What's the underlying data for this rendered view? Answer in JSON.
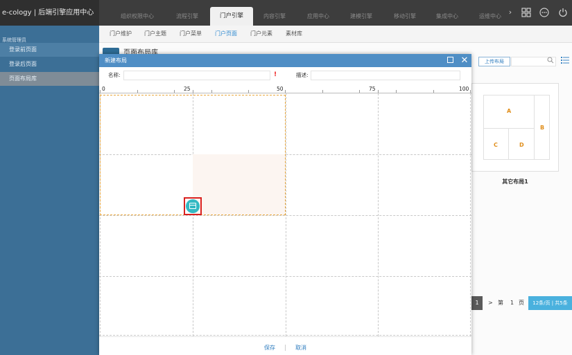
{
  "app": {
    "brand": "e-cology | 后端引擎应用中心"
  },
  "top_nav": {
    "tabs": [
      {
        "label": "组织权限中心"
      },
      {
        "label": "流程引擎"
      },
      {
        "label": "门户引擎"
      },
      {
        "label": "内容引擎"
      },
      {
        "label": "应用中心"
      },
      {
        "label": "建模引擎"
      },
      {
        "label": "移动引擎"
      },
      {
        "label": "集成中心"
      },
      {
        "label": "运维中心"
      }
    ],
    "active_tab": "门户引擎",
    "more_icon": "chevron-right-icon",
    "icons": [
      "grid-icon",
      "more-icon",
      "power-icon"
    ]
  },
  "sub_nav": {
    "items": [
      {
        "label": "门户维护"
      },
      {
        "label": "门户主题"
      },
      {
        "label": "门户菜单"
      },
      {
        "label": "门户页面"
      },
      {
        "label": "门户元素"
      },
      {
        "label": "素材库"
      }
    ],
    "active": "门户页面"
  },
  "sidebar": {
    "header": "系统管理员",
    "items": [
      {
        "label": "登录前页面"
      },
      {
        "label": "登录后页面"
      },
      {
        "label": "页面布局库"
      }
    ],
    "active": "页面布局库"
  },
  "main": {
    "page_title": "页面布局库",
    "upload_button": "上传布局",
    "card": {
      "label": "其它布局1",
      "regions": [
        "A",
        "B",
        "C",
        "D"
      ]
    },
    "pager": {
      "current_page": "1",
      "next": ">",
      "goto_prefix": "第",
      "goto_value": "1",
      "goto_suffix": "页",
      "info": "12条/页 | 共5条"
    }
  },
  "dialog": {
    "title": "新建布局",
    "name_label": "名称:",
    "name_value": "",
    "required_mark": "!",
    "desc_label": "描述:",
    "desc_value": "",
    "ruler": {
      "ticks": [
        "0",
        "25",
        "50",
        "75",
        "100"
      ]
    },
    "grid": {
      "columns": 4,
      "rows": 4
    },
    "save_button": "保存",
    "cancel_button": "取消"
  },
  "colors": {
    "topbar": "#3d3d3d",
    "sidebar": "#3c6f96",
    "dialog_header": "#4f8ec5",
    "accent": "#2f7dbf",
    "selection": "#e9a63a",
    "drag_handle": "#33b9c3",
    "highlight_box": "#d9211f",
    "pager_info": "#4ab1de"
  }
}
